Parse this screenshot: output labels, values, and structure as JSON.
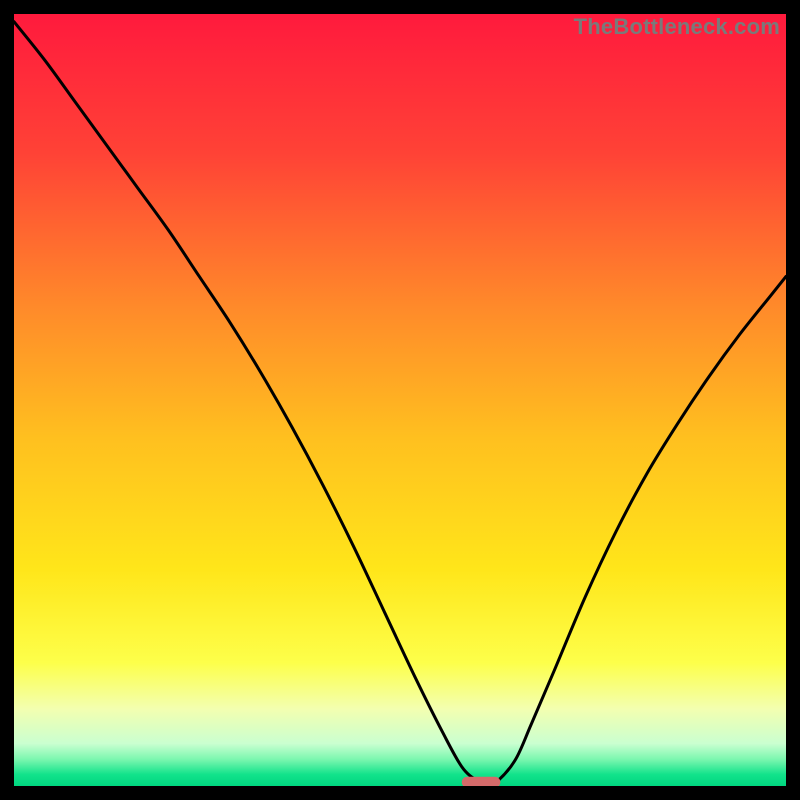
{
  "watermark": "TheBottleneck.com",
  "chart_data": {
    "type": "line",
    "title": "",
    "xlabel": "",
    "ylabel": "",
    "xlim": [
      0,
      100
    ],
    "ylim": [
      0,
      100
    ],
    "gradient_stops": [
      {
        "offset": 0.0,
        "color": "#ff1a3d"
      },
      {
        "offset": 0.18,
        "color": "#ff4236"
      },
      {
        "offset": 0.38,
        "color": "#ff8a2a"
      },
      {
        "offset": 0.55,
        "color": "#ffc01f"
      },
      {
        "offset": 0.72,
        "color": "#ffe61a"
      },
      {
        "offset": 0.84,
        "color": "#fdff4a"
      },
      {
        "offset": 0.9,
        "color": "#f3ffb0"
      },
      {
        "offset": 0.945,
        "color": "#caffd0"
      },
      {
        "offset": 0.965,
        "color": "#7df7b0"
      },
      {
        "offset": 0.985,
        "color": "#12e38b"
      },
      {
        "offset": 1.0,
        "color": "#00d680"
      }
    ],
    "series": [
      {
        "name": "bottleneck-curve",
        "x": [
          0.0,
          4.0,
          8.0,
          12.0,
          16.0,
          20.0,
          24.0,
          28.0,
          32.0,
          36.0,
          40.0,
          44.0,
          48.0,
          52.0,
          55.5,
          58.0,
          60.0,
          61.5,
          62.8,
          65.0,
          67.0,
          70.0,
          74.0,
          78.0,
          82.0,
          86.0,
          90.0,
          94.0,
          98.0,
          100.0
        ],
        "y": [
          99.0,
          94.0,
          88.5,
          83.0,
          77.5,
          72.0,
          66.0,
          60.0,
          53.5,
          46.5,
          39.0,
          31.0,
          22.5,
          14.0,
          7.0,
          2.5,
          0.7,
          0.4,
          0.8,
          3.5,
          8.0,
          15.0,
          24.5,
          33.0,
          40.5,
          47.0,
          53.0,
          58.5,
          63.5,
          66.0
        ]
      }
    ],
    "marker": {
      "name": "optimal-marker",
      "x": 60.5,
      "y": 0.5,
      "width": 5.0,
      "height": 1.4,
      "color": "#d46a6a"
    }
  }
}
